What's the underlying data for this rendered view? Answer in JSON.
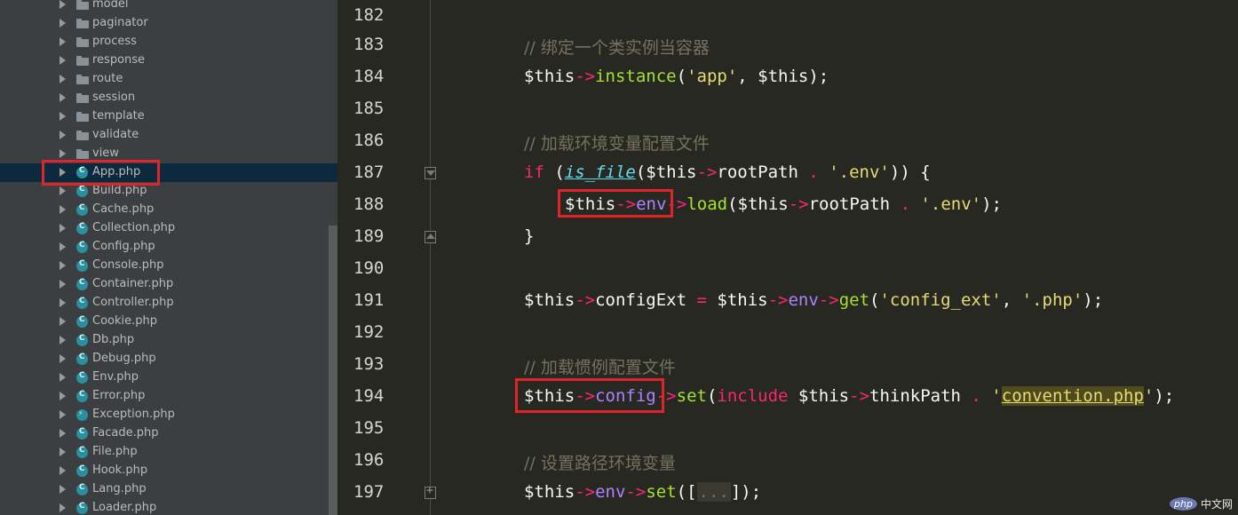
{
  "sidebar": {
    "items": [
      {
        "label": "model",
        "type": "folder"
      },
      {
        "label": "paginator",
        "type": "folder"
      },
      {
        "label": "process",
        "type": "folder"
      },
      {
        "label": "response",
        "type": "folder"
      },
      {
        "label": "route",
        "type": "folder"
      },
      {
        "label": "session",
        "type": "folder"
      },
      {
        "label": "template",
        "type": "folder"
      },
      {
        "label": "validate",
        "type": "folder"
      },
      {
        "label": "view",
        "type": "folder"
      },
      {
        "label": "App.php",
        "type": "class",
        "selected": true
      },
      {
        "label": "Build.php",
        "type": "class"
      },
      {
        "label": "Cache.php",
        "type": "class"
      },
      {
        "label": "Collection.php",
        "type": "class"
      },
      {
        "label": "Config.php",
        "type": "class"
      },
      {
        "label": "Console.php",
        "type": "class"
      },
      {
        "label": "Container.php",
        "type": "class"
      },
      {
        "label": "Controller.php",
        "type": "class"
      },
      {
        "label": "Cookie.php",
        "type": "class"
      },
      {
        "label": "Db.php",
        "type": "class"
      },
      {
        "label": "Debug.php",
        "type": "class"
      },
      {
        "label": "Env.php",
        "type": "class"
      },
      {
        "label": "Error.php",
        "type": "class"
      },
      {
        "label": "Exception.php",
        "type": "exception"
      },
      {
        "label": "Facade.php",
        "type": "class"
      },
      {
        "label": "File.php",
        "type": "class"
      },
      {
        "label": "Hook.php",
        "type": "class"
      },
      {
        "label": "Lang.php",
        "type": "class"
      },
      {
        "label": "Loader.php",
        "type": "class"
      }
    ]
  },
  "editor": {
    "line_numbers": [
      "182",
      "183",
      "184",
      "185",
      "186",
      "187",
      "188",
      "189",
      "190",
      "191",
      "192",
      "193",
      "194",
      "195",
      "196",
      "197"
    ],
    "lines": {
      "l183_comment": "// 绑定一个类实例当容器",
      "l184": {
        "var": "$this",
        "arrow": "->",
        "method": "instance",
        "p1": "(",
        "s1": "'app'",
        "rest": ", $this);"
      },
      "l186_comment": "// 加载环境变量配置文件",
      "l187": {
        "kw": "if",
        "p1": " (",
        "fn": "is_file",
        "p2": "($this",
        "arrow": "->",
        "prop": "rootPath",
        "dot": " . ",
        "s1": "'.env'",
        "end": ")) {"
      },
      "l188": {
        "var": "$this",
        "arrow1": "->",
        "prop": "env",
        "arrow2": "->",
        "method": "load",
        "p1": "($this",
        "arrow3": "->",
        "prop2": "rootPath",
        "dot": " . ",
        "s1": "'.env'",
        "end": ");"
      },
      "l189": "}",
      "l191": {
        "var": "$this",
        "arrow1": "->",
        "prop": "configExt",
        "eq": " = ",
        "var2": "$this",
        "arrow2": "->",
        "prop2": "env",
        "arrow3": "->",
        "method": "get",
        "p1": "(",
        "s1": "'config_ext'",
        "comma": ", ",
        "s2": "'.php'",
        "end": ");"
      },
      "l193_comment": "// 加载惯例配置文件",
      "l194": {
        "var": "$this",
        "arrow1": "->",
        "prop": "config",
        "arrow2": "->",
        "method": "set",
        "p1": "(",
        "kw": "include",
        "var2": " $this",
        "arrow3": "->",
        "prop2": "thinkPath",
        "dot": " . ",
        "q1": "'",
        "s1": "convention.php",
        "q2": "'",
        "end": ");"
      },
      "l196_comment": "// 设置路径环境变量",
      "l197": {
        "var": "$this",
        "arrow1": "->",
        "prop": "env",
        "arrow2": "->",
        "method": "set",
        "p1": "([",
        "collapsed": "...",
        "end": "]);"
      }
    }
  },
  "watermark": {
    "logo": "php",
    "text": "中文网"
  },
  "colors": {
    "highlight_box": "#e0242b",
    "comment": "#75715e",
    "keyword": "#f92672",
    "function": "#a6e22e",
    "string": "#e6db74",
    "property": "#ae81ff"
  }
}
